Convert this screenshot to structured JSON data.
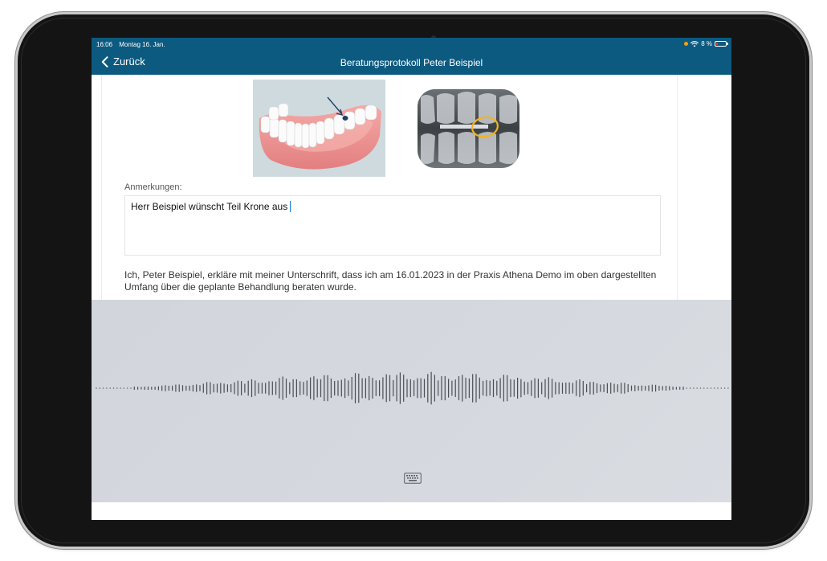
{
  "status_bar": {
    "time": "16:06",
    "date": "Montag 16. Jan.",
    "battery_text": "8 %",
    "indicator_color": "#ff9f0a"
  },
  "nav": {
    "back_label": "Zurück",
    "title": "Beratungsprotokoll Peter Beispiel",
    "bar_color": "#0c5a80"
  },
  "images": {
    "teeth_illustration": "dental-arch-illustration",
    "xray": "dental-xray-image"
  },
  "notes": {
    "label": "Anmerkungen:",
    "value": "Herr Beispiel wünscht Teil Krone aus"
  },
  "consent_text": "Ich, Peter Beispiel, erkläre mit meiner Unterschrift, dass ich am 16.01.2023 in der Praxis Athena Demo im oben dargestellten Umfang über die geplante Behandlung beraten wurde.",
  "dictation": {
    "state": "listening",
    "keyboard_icon": "keyboard-icon"
  }
}
